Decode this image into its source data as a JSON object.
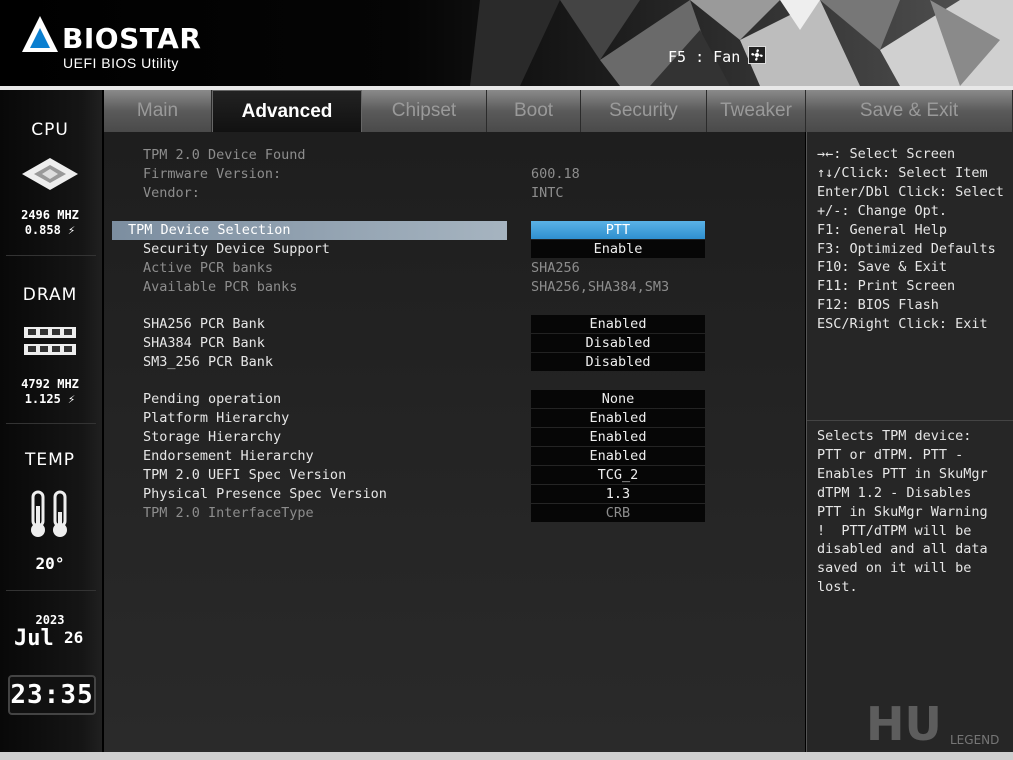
{
  "header": {
    "brand": "BIOSTAR",
    "subtitle": "UEFI BIOS Utility",
    "fan_shortcut": "F5 : Fan"
  },
  "sidebar": {
    "cpu": {
      "label": "CPU",
      "freq": "2496 MHZ",
      "volt": "0.858 ⚡"
    },
    "dram": {
      "label": "DRAM",
      "freq": "4792 MHZ",
      "volt": "1.125 ⚡"
    },
    "temp": {
      "label": "TEMP",
      "value": "20°"
    },
    "date": {
      "year": "2023",
      "month": "Jul",
      "day": "26"
    },
    "time": "23:35"
  },
  "tabs": [
    {
      "label": "Main"
    },
    {
      "label": "Advanced",
      "active": true
    },
    {
      "label": "Chipset"
    },
    {
      "label": "Boot"
    },
    {
      "label": "Security"
    },
    {
      "label": "Tweaker"
    },
    {
      "label": "Save & Exit"
    }
  ],
  "settings": [
    {
      "label": "TPM 2.0 Device Found",
      "dim": true
    },
    {
      "label": "Firmware Version:",
      "value": "600.18",
      "dim": true
    },
    {
      "label": "Vendor:",
      "value": "INTC",
      "dim": true
    },
    {
      "label": "TPM Device Selection",
      "option": "PTT",
      "selected": true
    },
    {
      "label": "Security Device Support",
      "option": "Enable"
    },
    {
      "label": "Active PCR banks",
      "value": "SHA256",
      "dim": true
    },
    {
      "label": "Available PCR banks",
      "value": "SHA256,SHA384,SM3",
      "dim": true
    },
    {
      "label": "SHA256 PCR Bank",
      "option": "Enabled"
    },
    {
      "label": "SHA384 PCR Bank",
      "option": "Disabled"
    },
    {
      "label": "SM3_256 PCR Bank",
      "option": "Disabled"
    },
    {
      "label": "Pending operation",
      "option": "None"
    },
    {
      "label": "Platform Hierarchy",
      "option": "Enabled"
    },
    {
      "label": "Storage Hierarchy",
      "option": "Enabled"
    },
    {
      "label": "Endorsement Hierarchy",
      "option": "Enabled"
    },
    {
      "label": "TPM 2.0 UEFI Spec Version",
      "option": "TCG_2"
    },
    {
      "label": "Physical Presence Spec Version",
      "option": "1.3"
    },
    {
      "label": "TPM 2.0 InterfaceType",
      "option": "CRB",
      "dim": true
    }
  ],
  "key_help": [
    "→←: Select Screen",
    "↑↓/Click: Select Item",
    "Enter/Dbl Click: Select",
    "+/-: Change Opt.",
    "F1: General Help",
    "F3: Optimized Defaults",
    "F10: Save & Exit",
    "F11: Print Screen",
    "F12: BIOS Flash",
    "ESC/Right Click: Exit"
  ],
  "item_help": [
    "Selects TPM device:",
    "PTT or dTPM. PTT -",
    "Enables PTT in SkuMgr",
    "dTPM 1.2 - Disables",
    "PTT in SkuMgr Warning",
    "!  PTT/dTPM will be",
    "disabled and all data",
    "saved on it will be",
    "lost."
  ],
  "watermark": {
    "mark": "HU",
    "text": "LEGEND"
  },
  "colors": {
    "accent": "#3a9ad9",
    "highlight": "#8fa0b0"
  }
}
